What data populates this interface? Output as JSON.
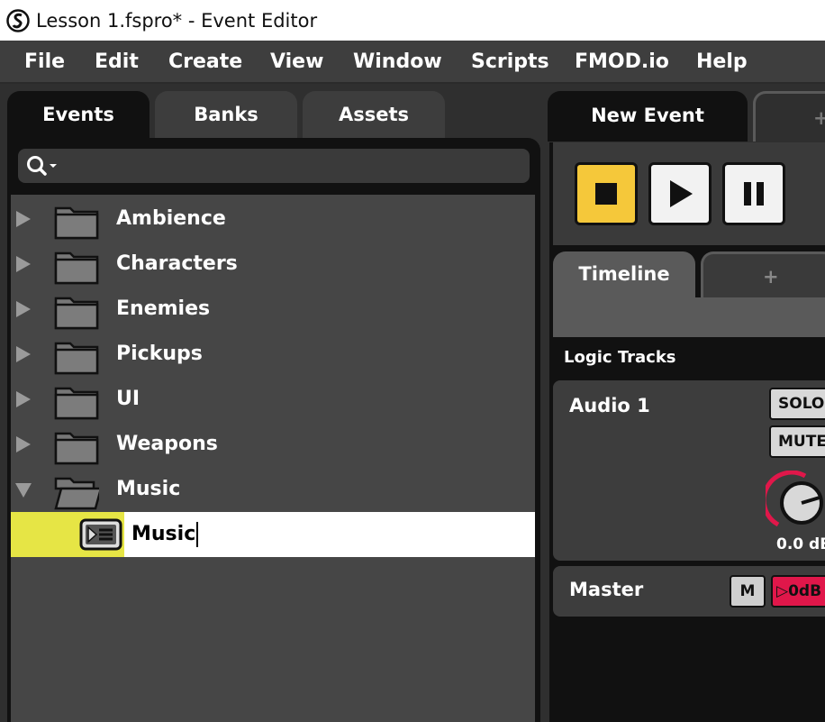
{
  "window": {
    "title": "Lesson 1.fspro* - Event Editor"
  },
  "menu": [
    "File",
    "Edit",
    "Create",
    "View",
    "Window",
    "Scripts",
    "FMOD.io",
    "Help"
  ],
  "browser_tabs": [
    "Events",
    "Banks",
    "Assets"
  ],
  "search": {
    "placeholder": ""
  },
  "folders": [
    {
      "label": "Ambience",
      "expanded": false
    },
    {
      "label": "Characters",
      "expanded": false
    },
    {
      "label": "Enemies",
      "expanded": false
    },
    {
      "label": "Pickups",
      "expanded": false
    },
    {
      "label": "UI",
      "expanded": false
    },
    {
      "label": "Weapons",
      "expanded": false
    },
    {
      "label": "Music",
      "expanded": true
    }
  ],
  "selected_event": {
    "name": "Music"
  },
  "editor": {
    "tab": "New Event",
    "add_tab": "+",
    "timeline_tab": "Timeline",
    "add_sheet": "+",
    "logic_tracks": "Logic Tracks",
    "track": {
      "name": "Audio 1",
      "solo": "SOLO",
      "mute": "MUTE",
      "volume": "0.0 dB"
    },
    "master": {
      "name": "Master",
      "m": "M",
      "level": "▷0dB"
    }
  },
  "colors": {
    "accent_yellow": "#e6e545",
    "stop_button": "#f5c83a",
    "red": "#e0174a"
  }
}
